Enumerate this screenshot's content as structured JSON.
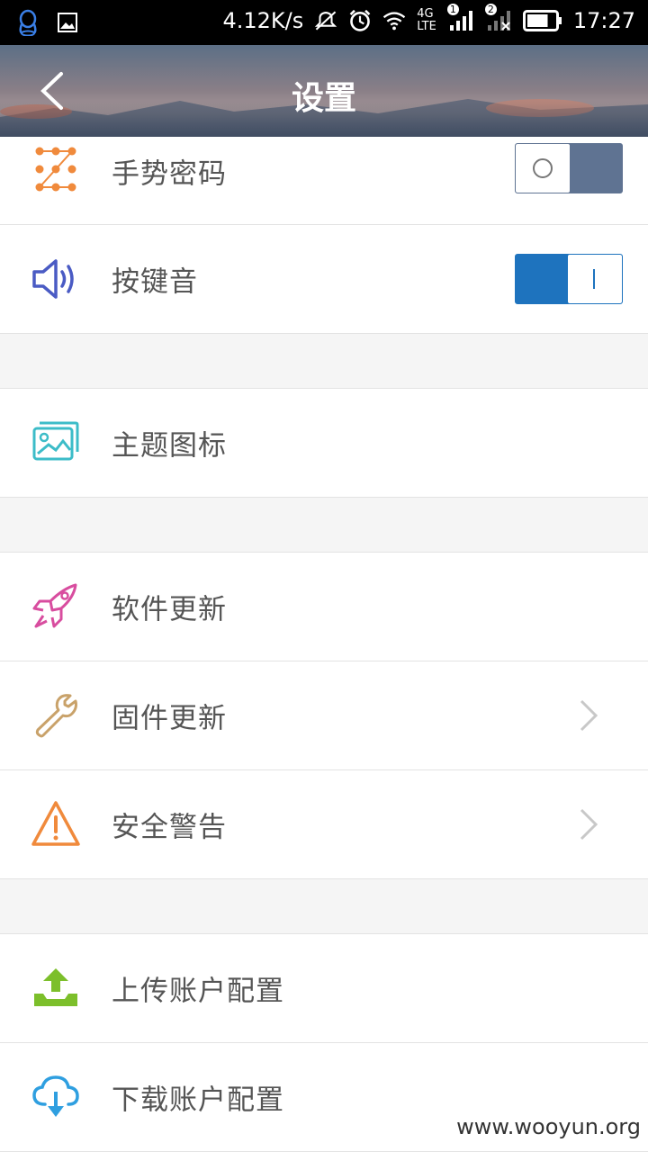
{
  "statusbar": {
    "net_speed": "4.12K/s",
    "net_type_top": "4G",
    "net_type_bottom": "LTE",
    "sim1": "1",
    "sim2": "2",
    "time": "17:27",
    "battery_level": 0.75,
    "icons": [
      "qq-icon",
      "gallery-icon",
      "mute-icon",
      "alarm-icon",
      "wifi-icon",
      "signal-icon",
      "battery-icon"
    ]
  },
  "header": {
    "title": "设置",
    "back_icon": "chevron-left-icon"
  },
  "settings": {
    "gesture_password": {
      "label": "手势密码",
      "enabled": false,
      "icon": "gesture-grid-icon",
      "color": "#f08a3c"
    },
    "key_sound": {
      "label": "按键音",
      "enabled": true,
      "icon": "speaker-icon",
      "color": "#4a5bc4"
    },
    "theme_icon": {
      "label": "主题图标",
      "icon": "picture-icon",
      "color": "#3cbcc8"
    },
    "software_update": {
      "label": "软件更新",
      "icon": "rocket-icon",
      "color": "#d84d9f"
    },
    "firmware_update": {
      "label": "固件更新",
      "icon": "wrench-icon",
      "color": "#c9a26a"
    },
    "security_alert": {
      "label": "安全警告",
      "icon": "warning-icon",
      "color": "#f08a3c"
    },
    "upload_config": {
      "label": "上传账户配置",
      "icon": "upload-tray-icon",
      "color": "#7cbf2b"
    },
    "download_config": {
      "label": "下载账户配置",
      "icon": "cloud-download-icon",
      "color": "#2f9fe0"
    }
  },
  "colors": {
    "toggle_on": "#1e73be",
    "toggle_off": "#5f7392"
  },
  "watermark": "www.wooyun.org"
}
